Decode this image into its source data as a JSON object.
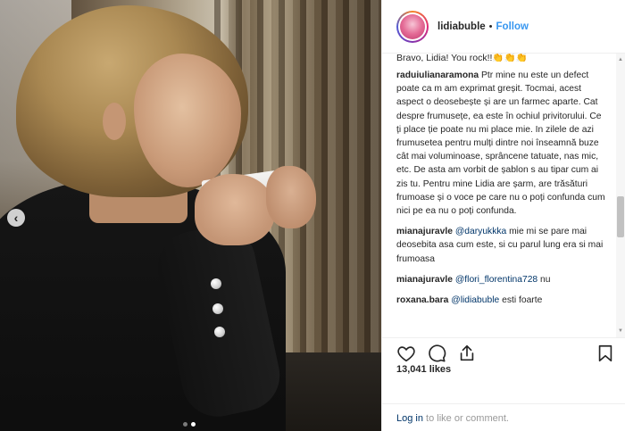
{
  "header": {
    "username": "lidiabuble",
    "separator": "•",
    "follow_label": "Follow"
  },
  "carousel": {
    "prev_arrow": "‹",
    "slide_count": 2,
    "active_slide": 2
  },
  "comments": {
    "top_fragment": "Bravo, Lidia! You rock!!👏👏👏",
    "items": [
      {
        "user": "raduiulianaramona",
        "text": "Ptr mine nu este un defect poate ca m am exprimat greșit. Tocmai, acest aspect o deosebește și are un farmec aparte. Cat despre frumusețe, ea este în ochiul privitorului. Ce ți place ție poate nu mi place mie. In zilele de azi frumusetea pentru mulți dintre noi înseamnă buze cât mai voluminoase, sprâncene tatuate, nas mic, etc. De asta am vorbit de șablon s au tipar cum ai zis tu. Pentru mine Lidia are șarm, are trăsături frumoase și o voce pe care nu o poți confunda cum nici pe ea nu o poți confunda."
      },
      {
        "user": "mianajuravle",
        "mention": "@daryukkka",
        "text": "mie mi se pare mai deosebita asa cum este, si cu parul lung era si mai frumoasa"
      },
      {
        "user": "mianajuravle",
        "mention": "@flori_florentina728",
        "text": "nu"
      },
      {
        "user": "roxana.bara",
        "mention": "@lidiabuble",
        "text": "esti foarte"
      }
    ]
  },
  "actions": {
    "like_icon": "heart-icon",
    "comment_icon": "comment-icon",
    "share_icon": "share-icon",
    "save_icon": "bookmark-icon"
  },
  "likes": "13,041 likes",
  "login": {
    "link": "Log in",
    "rest": "to like or comment."
  },
  "colors": {
    "link_blue": "#3897f0",
    "mention_blue": "#003569",
    "text": "#262626",
    "muted": "#999999"
  }
}
